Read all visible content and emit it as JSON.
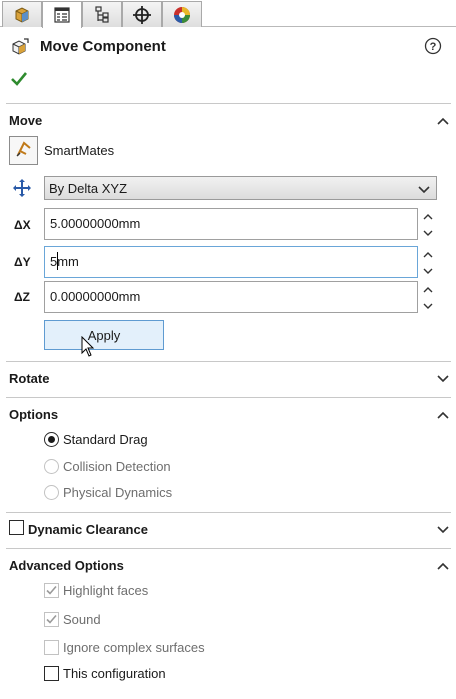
{
  "tabs": [
    {
      "icon": "feature-manager-icon",
      "active": false
    },
    {
      "icon": "property-manager-icon",
      "active": true
    },
    {
      "icon": "configuration-manager-icon",
      "active": false
    },
    {
      "icon": "dimxpert-manager-icon",
      "active": false
    },
    {
      "icon": "display-manager-icon",
      "active": false
    }
  ],
  "header": {
    "title": "Move Component",
    "icon": "move-component-icon",
    "help_icon": "help-icon",
    "ok_icon": "checkmark-icon"
  },
  "move": {
    "title": "Move",
    "smartmates_label": "SmartMates",
    "mode": "By Delta XYZ",
    "fields": [
      {
        "label": "ΔX",
        "value": "5.00000000mm"
      },
      {
        "label": "ΔY",
        "value": "5mm"
      },
      {
        "label": "ΔZ",
        "value": "0.00000000mm"
      }
    ],
    "apply_label": "Apply"
  },
  "rotate": {
    "title": "Rotate"
  },
  "options": {
    "title": "Options",
    "items": [
      {
        "label": "Standard Drag",
        "selected": true,
        "enabled": true
      },
      {
        "label": "Collision Detection",
        "selected": false,
        "enabled": false
      },
      {
        "label": "Physical Dynamics",
        "selected": false,
        "enabled": false
      }
    ]
  },
  "dynamic_clearance": {
    "title": "Dynamic Clearance",
    "checked": false
  },
  "advanced": {
    "title": "Advanced Options",
    "items": [
      {
        "label": "Highlight faces",
        "checked": true,
        "enabled": false
      },
      {
        "label": "Sound",
        "checked": true,
        "enabled": false
      },
      {
        "label": "Ignore complex surfaces",
        "checked": false,
        "enabled": false
      },
      {
        "label": "This configuration",
        "checked": false,
        "enabled": true
      }
    ]
  },
  "colors": {
    "accent": "#5f9bd1",
    "ok_green": "#2e8b2e",
    "disabled_text": "#6e6e6e"
  }
}
